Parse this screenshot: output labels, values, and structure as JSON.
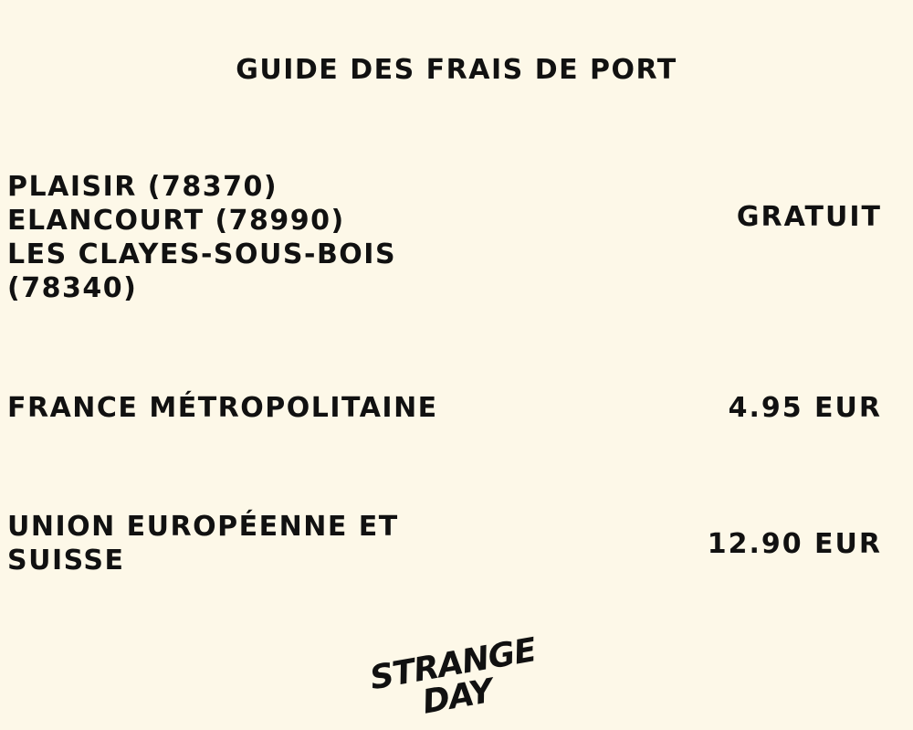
{
  "page": {
    "title": "GUIDE DES FRAIS DE PORT"
  },
  "shipping": {
    "local": {
      "regions": [
        "PLAISIR (78370)",
        "ELANCOURT (78990)",
        "LES CLAYES-SOUS-BOIS (78340)"
      ],
      "price": "GRATUIT"
    },
    "france": {
      "region": "FRANCE MÉTROPOLITAINE",
      "price": "4.95 EUR"
    },
    "eu": {
      "region": "UNION EUROPÉENNE ET SUISSE",
      "price": "12.90 EUR"
    }
  },
  "logo": {
    "line1": "STRANGE",
    "line2": "DAY"
  },
  "colors": {
    "background": "#fdf8e8",
    "text": "#111111"
  }
}
